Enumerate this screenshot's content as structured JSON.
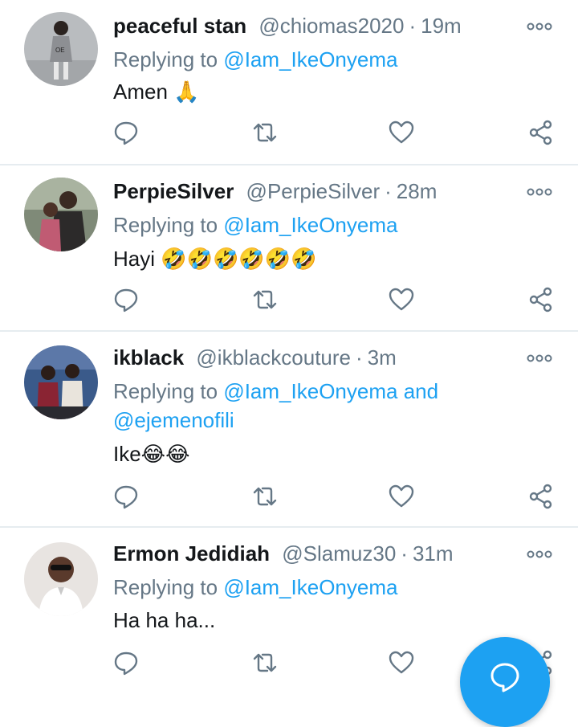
{
  "tweets": [
    {
      "name": "peaceful stan",
      "handle": "@chiomas2020",
      "separator": "·",
      "time": "19m",
      "reply_prefix": "Replying to",
      "reply_mentions": "@Iam_IkeOnyema",
      "reply_and": "",
      "reply_mentions_2": "",
      "text": "Amen 🙏"
    },
    {
      "name": "PerpieSilver",
      "handle": "@PerpieSilver",
      "separator": "·",
      "time": "28m",
      "reply_prefix": "Replying to",
      "reply_mentions": "@Iam_IkeOnyema",
      "reply_and": "",
      "reply_mentions_2": "",
      "text": "Hayi 🤣🤣🤣🤣🤣🤣"
    },
    {
      "name": "ikblack",
      "handle": "@ikblackcouture",
      "separator": "·",
      "time": "3m",
      "reply_prefix": "Replying to",
      "reply_mentions": "@Iam_IkeOnyema",
      "reply_and": "and",
      "reply_mentions_2": "@ejemenofili",
      "text": "Ike😂😂"
    },
    {
      "name": "Ermon Jedidiah",
      "handle": "@Slamuz30",
      "separator": "·",
      "time": "31m",
      "reply_prefix": "Replying to",
      "reply_mentions": "@Iam_IkeOnyema",
      "reply_and": "",
      "reply_mentions_2": "",
      "text": "Ha ha ha..."
    }
  ],
  "colors": {
    "name": "#14171a",
    "secondary": "#657786",
    "accent": "#1da1f2",
    "divider": "#e6ecf0"
  },
  "icons": [
    "reply-icon",
    "retweet-icon",
    "like-icon",
    "share-icon",
    "more-icon",
    "compose-icon"
  ]
}
